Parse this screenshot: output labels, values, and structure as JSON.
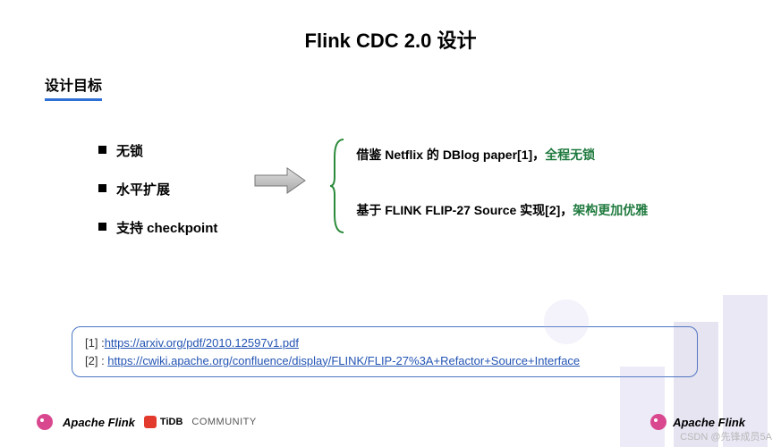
{
  "title": "Flink CDC 2.0 设计",
  "subtitle": "设计目标",
  "goals": [
    "无锁",
    "水平扩展",
    "支持 checkpoint"
  ],
  "details": [
    {
      "prefix": "借鉴 Netflix 的 DBlog  paper[1]，",
      "highlight": "全程无锁"
    },
    {
      "prefix": "基于 FLINK FLIP-27 Source 实现[2]，",
      "highlight": "架构更加优雅"
    }
  ],
  "refs": [
    {
      "label": "[1] :",
      "url": "https://arxiv.org/pdf/2010.12597v1.pdf"
    },
    {
      "label": "[2] : ",
      "url": "https://cwiki.apache.org/confluence/display/FLINK/FLIP-27%3A+Refactor+Source+Interface"
    }
  ],
  "footer": {
    "flink": "Apache Flink",
    "tidb": "TiDB",
    "community": "COMMUNITY"
  },
  "watermark": "CSDN @先锋成员5A"
}
